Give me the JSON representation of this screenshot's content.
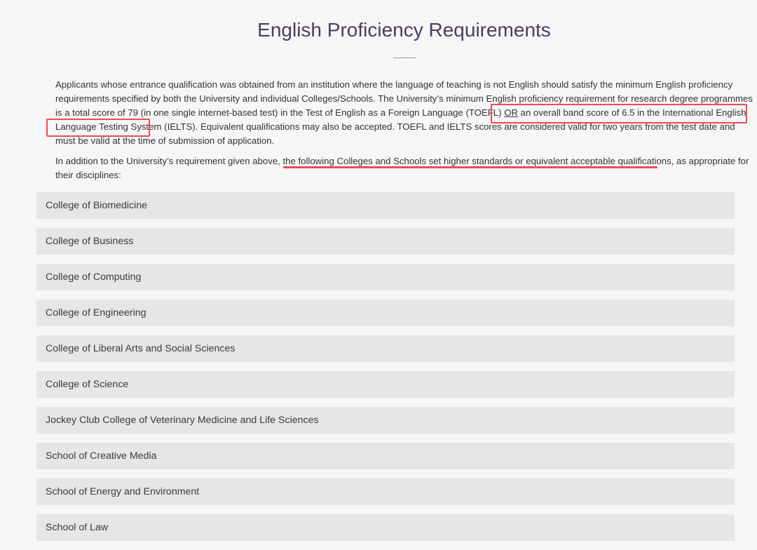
{
  "page": {
    "title": "English Proficiency Requirements"
  },
  "intro": {
    "p1_a": "Applicants whose entrance qualification was obtained from an institution where the language of teaching is not English should satisfy the minimum English proficiency requirements specified by both the University and individual Colleges/Schools. The University’s minimum English proficiency requirement for research degree programmes is a total score of 79 (in one single internet-based test) in the Test of English as a Foreign Language (TOEFL) ",
    "p1_or": "OR",
    "p1_b": " an overall band score of 6.5 in the International English Language Testing System (IELTS). Equivalent qualifications may also be accepted. TOEFL and IELTS scores are considered valid for two years from the test date and must be valid at the time of submission of application.",
    "p2": "In addition to the University’s requirement given above, the following Colleges and Schools set higher standards or equivalent acceptable qualifications, as appropriate for their disciplines:"
  },
  "colleges": [
    "College of Biomedicine",
    "College of Business",
    "College of Computing",
    "College of Engineering",
    "College of Liberal Arts and Social Sciences",
    "College of Science",
    "Jockey Club College of Veterinary Medicine and Life Sciences",
    "School of Creative Media",
    "School of Energy and Environment",
    "School of Law"
  ],
  "colors": {
    "title": "#4b3c63",
    "highlight": "#f04a57",
    "accordion_bg": "#e6e6e6",
    "page_bg": "#f6f6f6"
  }
}
